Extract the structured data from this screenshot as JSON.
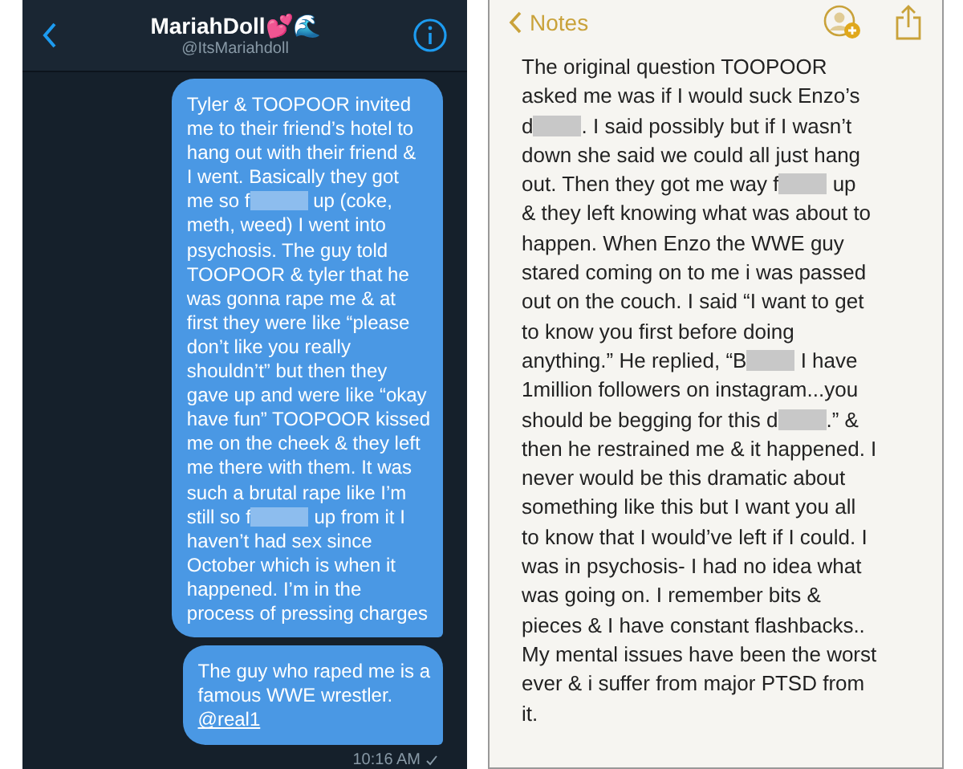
{
  "dm": {
    "title": "MariahDoll💕🌊",
    "handle": "@ItsMariahdoll",
    "messages": [
      {
        "lines": [
          "Tyler & TOOPOOR invited",
          "me to their friend’s hotel to",
          "hang out with their friend &",
          "I went. Basically they got",
          {
            "before": "me so f",
            "after": " up (coke,"
          },
          "meth, weed) I went into",
          "psychosis. The guy told",
          "TOOPOOR & tyler that he",
          "was gonna rape me & at",
          "first they were like “please",
          "don’t like you really",
          "shouldn’t” but then they",
          "gave up and were like “okay",
          "have fun” TOOPOOR kissed",
          "me on the cheek & they left",
          "me there with them. It was",
          "such a brutal rape like I’m",
          {
            "before": "still so f",
            "after": " up from it I"
          },
          "haven’t had sex since",
          "October which is when it",
          "happened. I’m in the",
          "process of pressing charges"
        ]
      },
      {
        "lines": [
          "The guy who raped me is a",
          "famous WWE wrestler."
        ],
        "link": "@real1"
      }
    ],
    "time": "10:16 AM",
    "read": true
  },
  "notes": {
    "back": "Notes",
    "lines": [
      "The original question TOOPOOR",
      "asked me was if I would suck Enzo’s",
      {
        "before": "d",
        "after": ". I said possibly but if I wasn’t"
      },
      "down she said we could all just hang",
      {
        "before": "out. Then they got me way f",
        "after": " up"
      },
      "& they left knowing what was about to",
      "happen. When Enzo the WWE guy",
      "stared coming on to me i was passed",
      "out on the couch. I said “I want to get",
      "to know you first before doing",
      {
        "before": "anything.” He replied, “B",
        "after": " I have"
      },
      "1million followers on instagram...you",
      {
        "before": "should be begging for this d",
        "after": ".” &"
      },
      "then he restrained me & it happened. I",
      "never would be this dramatic about",
      "something like this but I want you all",
      "to know that I would’ve left if I could. I",
      "was in psychosis- I had no idea what",
      "was going on. I remember bits &",
      "pieces & I have constant flashbacks..",
      "My mental issues have been the worst",
      "ever & i suffer from major PTSD from",
      "it."
    ]
  }
}
